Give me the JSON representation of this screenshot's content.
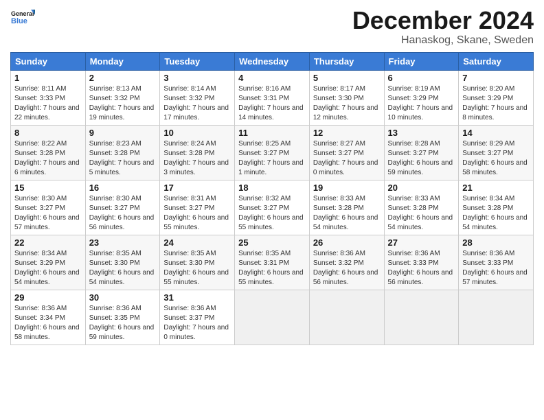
{
  "logo": {
    "text_general": "General",
    "text_blue": "Blue"
  },
  "header": {
    "month": "December 2024",
    "location": "Hanaskog, Skane, Sweden"
  },
  "weekdays": [
    "Sunday",
    "Monday",
    "Tuesday",
    "Wednesday",
    "Thursday",
    "Friday",
    "Saturday"
  ],
  "weeks": [
    [
      {
        "day": "1",
        "sunrise": "8:11 AM",
        "sunset": "3:33 PM",
        "daylight": "7 hours and 22 minutes."
      },
      {
        "day": "2",
        "sunrise": "8:13 AM",
        "sunset": "3:32 PM",
        "daylight": "7 hours and 19 minutes."
      },
      {
        "day": "3",
        "sunrise": "8:14 AM",
        "sunset": "3:32 PM",
        "daylight": "7 hours and 17 minutes."
      },
      {
        "day": "4",
        "sunrise": "8:16 AM",
        "sunset": "3:31 PM",
        "daylight": "7 hours and 14 minutes."
      },
      {
        "day": "5",
        "sunrise": "8:17 AM",
        "sunset": "3:30 PM",
        "daylight": "7 hours and 12 minutes."
      },
      {
        "day": "6",
        "sunrise": "8:19 AM",
        "sunset": "3:29 PM",
        "daylight": "7 hours and 10 minutes."
      },
      {
        "day": "7",
        "sunrise": "8:20 AM",
        "sunset": "3:29 PM",
        "daylight": "7 hours and 8 minutes."
      }
    ],
    [
      {
        "day": "8",
        "sunrise": "8:22 AM",
        "sunset": "3:28 PM",
        "daylight": "7 hours and 6 minutes."
      },
      {
        "day": "9",
        "sunrise": "8:23 AM",
        "sunset": "3:28 PM",
        "daylight": "7 hours and 5 minutes."
      },
      {
        "day": "10",
        "sunrise": "8:24 AM",
        "sunset": "3:28 PM",
        "daylight": "7 hours and 3 minutes."
      },
      {
        "day": "11",
        "sunrise": "8:25 AM",
        "sunset": "3:27 PM",
        "daylight": "7 hours and 1 minute."
      },
      {
        "day": "12",
        "sunrise": "8:27 AM",
        "sunset": "3:27 PM",
        "daylight": "7 hours and 0 minutes."
      },
      {
        "day": "13",
        "sunrise": "8:28 AM",
        "sunset": "3:27 PM",
        "daylight": "6 hours and 59 minutes."
      },
      {
        "day": "14",
        "sunrise": "8:29 AM",
        "sunset": "3:27 PM",
        "daylight": "6 hours and 58 minutes."
      }
    ],
    [
      {
        "day": "15",
        "sunrise": "8:30 AM",
        "sunset": "3:27 PM",
        "daylight": "6 hours and 57 minutes."
      },
      {
        "day": "16",
        "sunrise": "8:30 AM",
        "sunset": "3:27 PM",
        "daylight": "6 hours and 56 minutes."
      },
      {
        "day": "17",
        "sunrise": "8:31 AM",
        "sunset": "3:27 PM",
        "daylight": "6 hours and 55 minutes."
      },
      {
        "day": "18",
        "sunrise": "8:32 AM",
        "sunset": "3:27 PM",
        "daylight": "6 hours and 55 minutes."
      },
      {
        "day": "19",
        "sunrise": "8:33 AM",
        "sunset": "3:28 PM",
        "daylight": "6 hours and 54 minutes."
      },
      {
        "day": "20",
        "sunrise": "8:33 AM",
        "sunset": "3:28 PM",
        "daylight": "6 hours and 54 minutes."
      },
      {
        "day": "21",
        "sunrise": "8:34 AM",
        "sunset": "3:28 PM",
        "daylight": "6 hours and 54 minutes."
      }
    ],
    [
      {
        "day": "22",
        "sunrise": "8:34 AM",
        "sunset": "3:29 PM",
        "daylight": "6 hours and 54 minutes."
      },
      {
        "day": "23",
        "sunrise": "8:35 AM",
        "sunset": "3:30 PM",
        "daylight": "6 hours and 54 minutes."
      },
      {
        "day": "24",
        "sunrise": "8:35 AM",
        "sunset": "3:30 PM",
        "daylight": "6 hours and 55 minutes."
      },
      {
        "day": "25",
        "sunrise": "8:35 AM",
        "sunset": "3:31 PM",
        "daylight": "6 hours and 55 minutes."
      },
      {
        "day": "26",
        "sunrise": "8:36 AM",
        "sunset": "3:32 PM",
        "daylight": "6 hours and 56 minutes."
      },
      {
        "day": "27",
        "sunrise": "8:36 AM",
        "sunset": "3:33 PM",
        "daylight": "6 hours and 56 minutes."
      },
      {
        "day": "28",
        "sunrise": "8:36 AM",
        "sunset": "3:33 PM",
        "daylight": "6 hours and 57 minutes."
      }
    ],
    [
      {
        "day": "29",
        "sunrise": "8:36 AM",
        "sunset": "3:34 PM",
        "daylight": "6 hours and 58 minutes."
      },
      {
        "day": "30",
        "sunrise": "8:36 AM",
        "sunset": "3:35 PM",
        "daylight": "6 hours and 59 minutes."
      },
      {
        "day": "31",
        "sunrise": "8:36 AM",
        "sunset": "3:37 PM",
        "daylight": "7 hours and 0 minutes."
      },
      null,
      null,
      null,
      null
    ]
  ],
  "labels": {
    "sunrise": "Sunrise:",
    "sunset": "Sunset:",
    "daylight": "Daylight:"
  }
}
